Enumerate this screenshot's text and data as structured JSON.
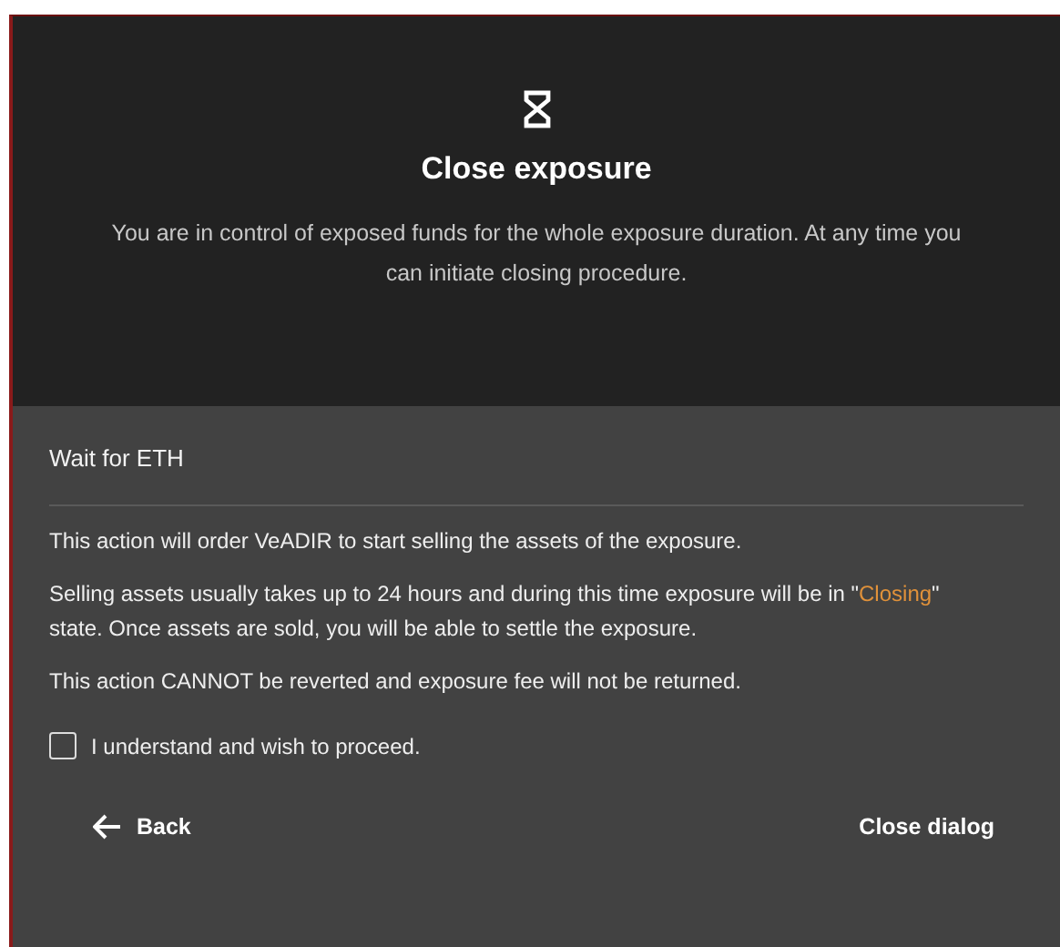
{
  "dialog": {
    "title": "Close exposure",
    "description": "You are in control of exposed funds for the whole exposure duration. At any time you can initiate closing procedure.",
    "section_title": "Wait for ETH",
    "paragraphs": [
      {
        "kind": "plain",
        "text": "This action will order VeADIR to start selling the assets of the exposure."
      },
      {
        "kind": "highlighted",
        "before": "Selling assets usually takes up to 24 hours and during this time exposure will be in \"",
        "highlight": "Closing",
        "after": "\" state. Once assets are sold, you will be able to settle the exposure."
      },
      {
        "kind": "plain",
        "text": "This action CANNOT be reverted and exposure fee will not be returned."
      }
    ],
    "checkbox": {
      "label": "I understand and wish to proceed.",
      "checked": false
    },
    "back_button": "Back",
    "close_button": "Close dialog"
  }
}
